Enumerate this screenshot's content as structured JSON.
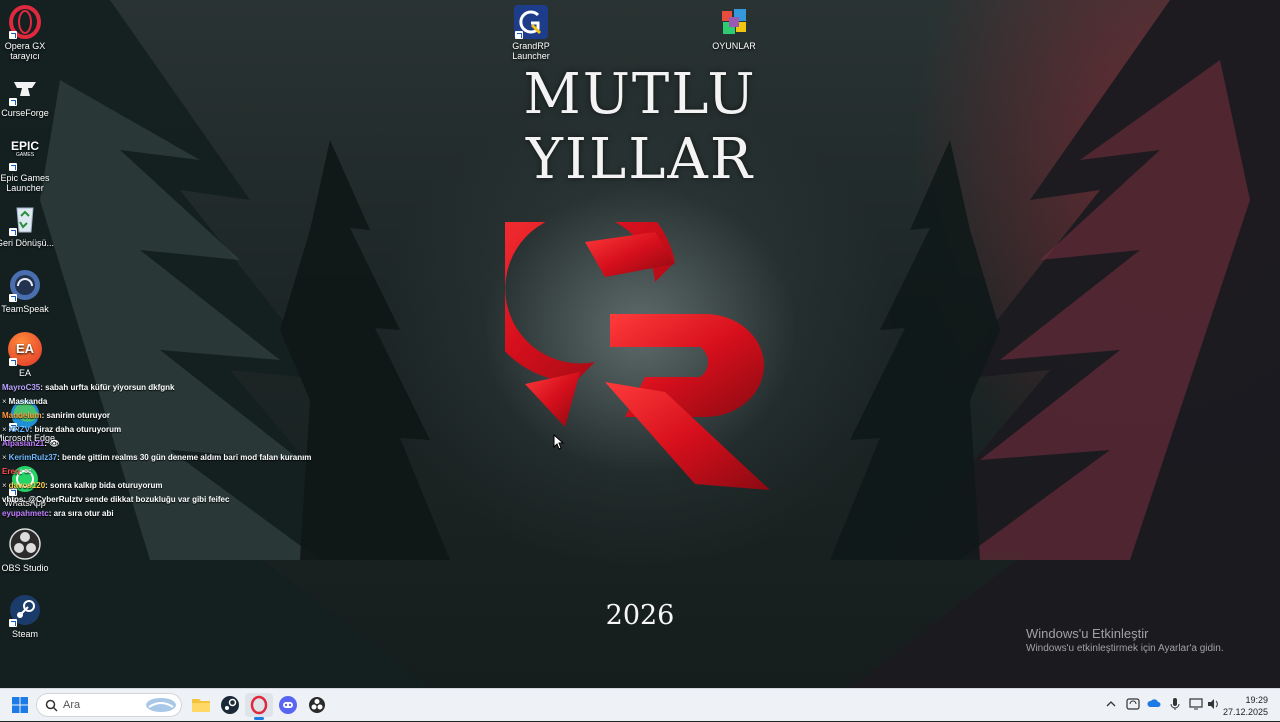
{
  "desktop": {
    "icons": [
      {
        "name": "opera-gx-icon",
        "label": "Opera GX tarayıcı"
      },
      {
        "name": "curseforge-icon",
        "label": "CurseForge"
      },
      {
        "name": "epic-games-icon",
        "label": "Epic Games Launcher",
        "glyph_top": "EPIC",
        "glyph_bottom": "GAMES"
      },
      {
        "name": "recycle-bin-icon",
        "label": "Geri Dönüşü..."
      },
      {
        "name": "teamspeak-icon",
        "label": "TeamSpeak"
      },
      {
        "name": "ea-icon",
        "label": "EA",
        "glyph": "EA"
      },
      {
        "name": "microsoft-edge-icon",
        "label": "Microsoft Edge"
      },
      {
        "name": "whatsapp-icon",
        "label": "WhatsApp"
      },
      {
        "name": "obs-studio-icon",
        "label": "OBS Studio"
      },
      {
        "name": "steam-icon",
        "label": "Steam"
      },
      {
        "name": "grandrp-launcher-icon",
        "label": "GrandRP Launcher"
      },
      {
        "name": "oyunlar-folder-icon",
        "label": "OYUNLAR"
      }
    ]
  },
  "wallpaper": {
    "title": "MUTLU YILLAR",
    "year": "2026",
    "logo": "grandrp-logo"
  },
  "chat": {
    "lines": [
      {
        "user": "MayroC35",
        "text": ": sabah urfta küfür yiyorsun dkfgnk",
        "color": "#b9a4ff",
        "x": false
      },
      {
        "user": "",
        "text": "Maskanda",
        "color": "#ffffff",
        "x": true
      },
      {
        "user": "Mandelum",
        "text": ": sanirim oturuyor",
        "color": "#ff9a3c",
        "x": false
      },
      {
        "user": "XRZV",
        "text": ": biraz daha oturuyorum",
        "color": "#6fb7ff",
        "x": true
      },
      {
        "user": "Alpaslan21",
        "text": ": 👁",
        "color": "#c07cff",
        "x": false
      },
      {
        "user": "KerimRulz37",
        "text": ": bende gittim realms 30 gün deneme aldım bari mod falan kuranım",
        "color": "#6fb7ff",
        "x": true
      },
      {
        "user": "Eren",
        "text": ": ✉",
        "color": "#ff4a4a",
        "x": false
      },
      {
        "user": "davos120",
        "text": ": sonra kalkıp bida oturuyorum",
        "color": "#ffd24a",
        "x": true
      },
      {
        "user": "vhtps",
        "text": ": @CyberRulztv sende dikkat bozukluğu var gibi feifec",
        "color": "#ffffff",
        "x": false
      },
      {
        "user": "eyupahmetc",
        "text": ": ara sıra otur abi",
        "color": "#c07cff",
        "x": false
      }
    ]
  },
  "activation": {
    "title": "Windows'u Etkinleştir",
    "subtitle": "Windows'u etkinleştirmek için Ayarlar'a gidin."
  },
  "taskbar": {
    "search_placeholder": "Ara",
    "pinned": [
      "start-icon",
      "file-explorer-icon",
      "steam-icon",
      "opera-gx-icon",
      "discord-icon",
      "obs-studio-icon"
    ],
    "tray": [
      "chevron-up-icon",
      "sync-icon",
      "network-cloud-icon",
      "microphone-icon",
      "display-icon",
      "volume-icon"
    ],
    "time": "19:29",
    "date": "27.12.2025"
  }
}
